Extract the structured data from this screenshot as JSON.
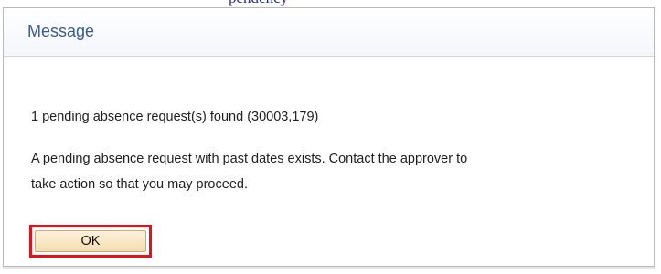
{
  "top_strip": {
    "text": "pendency"
  },
  "dialog": {
    "title": "Message",
    "messages": [
      "1 pending absence request(s) found (30003,179)",
      "A pending absence request with past dates exists. Contact the approver to",
      "take action so that you may proceed."
    ],
    "ok_label": "OK"
  },
  "colors": {
    "title": "#3a5c8c",
    "highlight": "#e0131a",
    "button_bg": "#f4ddb0"
  }
}
